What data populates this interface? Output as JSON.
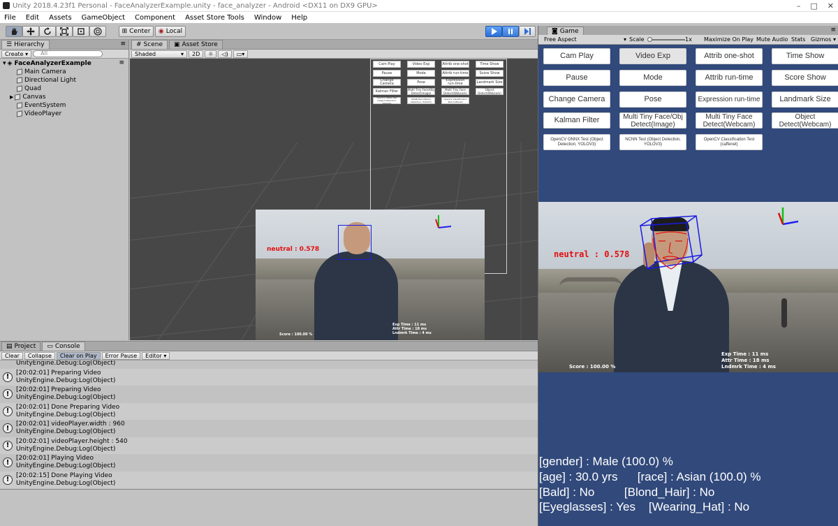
{
  "window": {
    "title": "Unity 2018.4.23f1 Personal - FaceAnalyzerExample.unity - face_analyzer - Android <DX11 on DX9 GPU>"
  },
  "menu": [
    "File",
    "Edit",
    "Assets",
    "GameObject",
    "Component",
    "Asset Store Tools",
    "Window",
    "Help"
  ],
  "toolbar": {
    "pivot": "Center",
    "space": "Local"
  },
  "hierarchy": {
    "tab": "Hierarchy",
    "create": "Create",
    "search_placeholder": "All",
    "scene": "FaceAnalyzerExample",
    "items": [
      "Main Camera",
      "Directional Light",
      "Quad",
      "Canvas",
      "EventSystem",
      "VideoPlayer"
    ]
  },
  "scene": {
    "tabs": [
      "Scene",
      "Asset Store"
    ],
    "shading": "Shaded",
    "mode_2d": "2D"
  },
  "game": {
    "tab": "Game",
    "aspect": "Free Aspect",
    "scale_label": "Scale",
    "scale_value": "1x",
    "options": [
      "Maximize On Play",
      "Mute Audio",
      "Stats",
      "Gizmos"
    ],
    "buttons": [
      [
        "Cam Play",
        "Video Exp",
        "Attrib one-shot",
        "Time Show"
      ],
      [
        "Pause",
        "Mode",
        "Attrib run-time",
        "Score Show"
      ],
      [
        "Change Camera",
        "Pose",
        "Expression run-time",
        "Landmark Size"
      ],
      [
        "Kalman Filter",
        "Multi Tiny Face/Obj Detect(Image)",
        "Multi Tiny Face Detect(Webcam)",
        "Object Detect(Webcam)"
      ],
      [
        "OpenCV ONNX Test (Object Detection, YOLOV3)",
        "NCNN Test (Object Detection, YOLOV3)",
        "OpenCV Classification Test (caffenet)"
      ]
    ],
    "expression": "neutral : 0.578",
    "timing": [
      "Exp Time : 11 ms",
      "Attr Time : 18 ms",
      "Lndmrk Time : 4 ms"
    ],
    "score": "Score : 100.00 %",
    "attributes": [
      "[gender] : Male (100.0) %",
      "[age] : 30.0 yrs      [race] : Asian (100.0) %",
      "[Bald] : No         [Blond_Hair] : No",
      "[Eyeglasses] : Yes    [Wearing_Hat] : No"
    ]
  },
  "console": {
    "tabs": [
      "Project",
      "Console"
    ],
    "toolbar": [
      "Clear",
      "Collapse",
      "Clear on Play",
      "Error Pause",
      "Editor"
    ],
    "first_partial": "UnityEngine.Debug:Log(Object)",
    "entries": [
      {
        "msg": "[20:02:01] Preparing Video",
        "src": "UnityEngine.Debug:Log(Object)"
      },
      {
        "msg": "[20:02:01] Preparing Video",
        "src": "UnityEngine.Debug:Log(Object)"
      },
      {
        "msg": "[20:02:01] Done Preparing Video",
        "src": "UnityEngine.Debug:Log(Object)"
      },
      {
        "msg": "[20:02:01] videoPlayer.width : 960",
        "src": "UnityEngine.Debug:Log(Object)"
      },
      {
        "msg": "[20:02:01] videoPlayer.height : 540",
        "src": "UnityEngine.Debug:Log(Object)"
      },
      {
        "msg": "[20:02:01] Playing Video",
        "src": "UnityEngine.Debug:Log(Object)"
      },
      {
        "msg": "[20:02:15] Done Playing Video",
        "src": "UnityEngine.Debug:Log(Object)"
      }
    ]
  },
  "colors": {
    "game_bg": "#31497b",
    "play_blue": "#2a6ed8",
    "overlay_red": "#e21010",
    "box_blue": "#1a1ae0"
  }
}
